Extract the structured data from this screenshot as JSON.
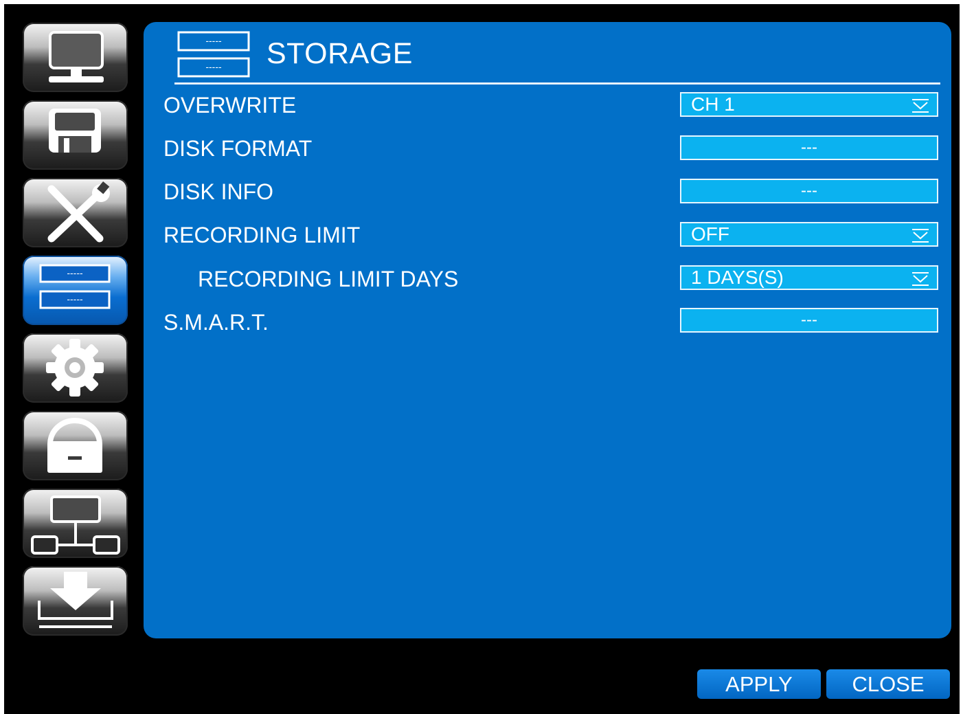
{
  "sidebar": {
    "items": [
      {
        "name": "display",
        "icon": "monitor-icon",
        "active": false
      },
      {
        "name": "record",
        "icon": "floppy-disk-icon",
        "active": false
      },
      {
        "name": "system",
        "icon": "tools-icon",
        "active": false
      },
      {
        "name": "storage",
        "icon": "storage-icon",
        "active": true,
        "icon_text": "-----"
      },
      {
        "name": "config",
        "icon": "gear-icon",
        "active": false
      },
      {
        "name": "security",
        "icon": "lock-icon",
        "active": false
      },
      {
        "name": "network",
        "icon": "network-icon",
        "active": false
      },
      {
        "name": "update",
        "icon": "download-icon",
        "active": false
      }
    ]
  },
  "header": {
    "title": "STORAGE",
    "icon": "storage-icon",
    "icon_text": "-----"
  },
  "settings": {
    "overwrite": {
      "label": "OVERWRITE",
      "value": "CH 1"
    },
    "disk_format": {
      "label": "DISK FORMAT",
      "value": "---"
    },
    "disk_info": {
      "label": "DISK INFO",
      "value": "---"
    },
    "recording_limit": {
      "label": "RECORDING LIMIT",
      "value": "OFF"
    },
    "recording_limit_days": {
      "label": "RECORDING LIMIT DAYS",
      "value": "1 DAYS(S)"
    },
    "smart": {
      "label": "S.M.A.R.T.",
      "value": "---"
    }
  },
  "footer": {
    "apply_label": "APPLY",
    "close_label": "CLOSE"
  },
  "colors": {
    "panel": "#0270c8",
    "field": "#0bb2f0",
    "background": "#000000"
  }
}
